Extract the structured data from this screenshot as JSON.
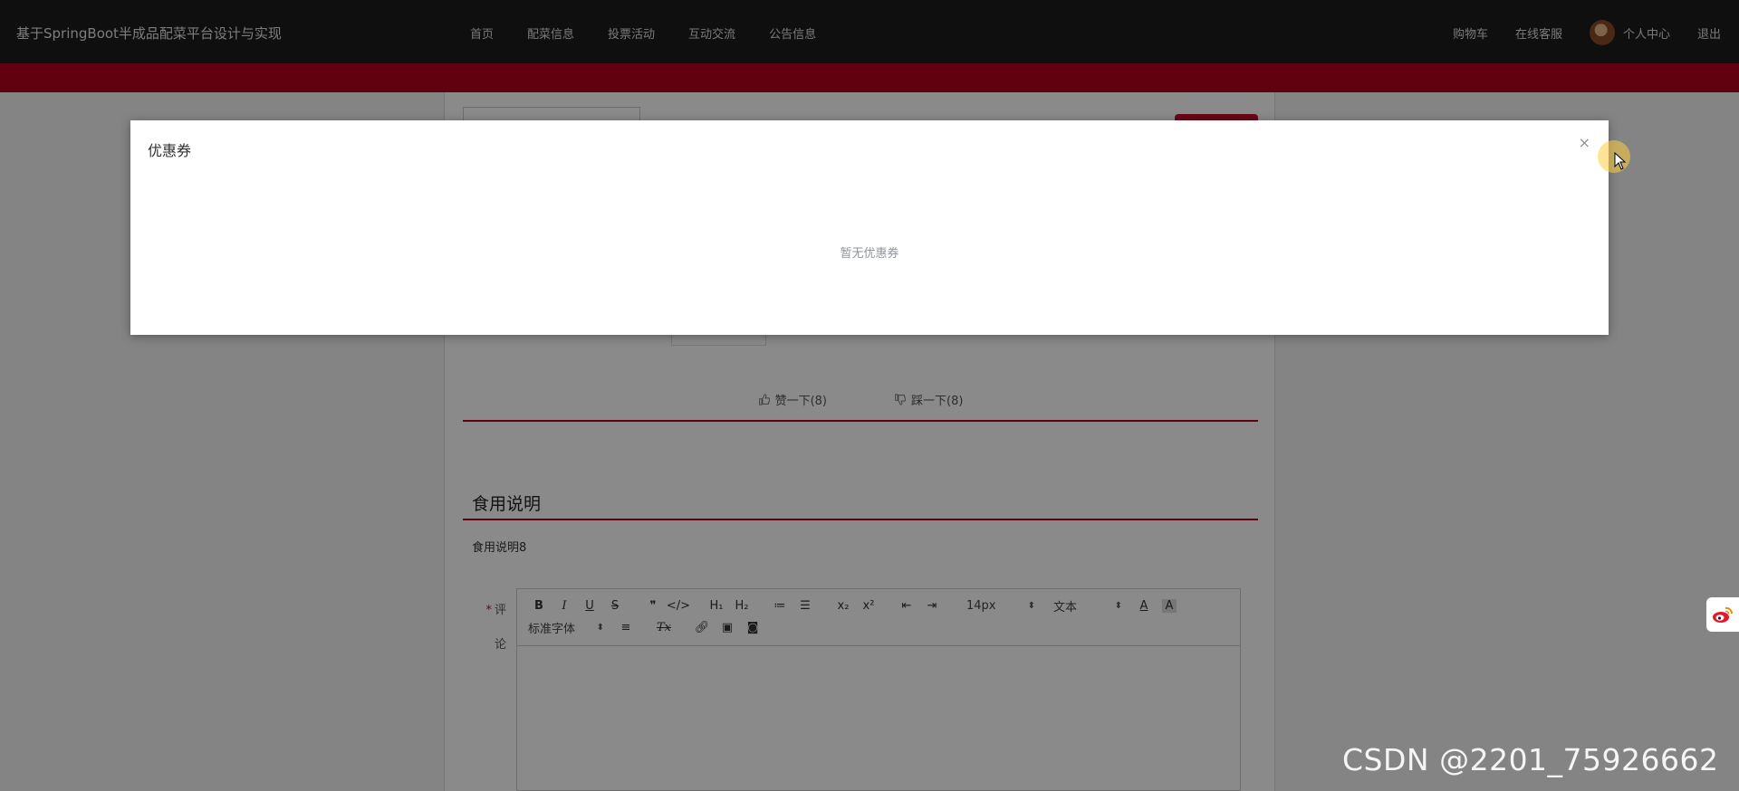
{
  "header": {
    "site_title": "基于SpringBoot半成品配菜平台设计与实现",
    "nav": [
      "首页",
      "配菜信息",
      "投票活动",
      "互动交流",
      "公告信息"
    ],
    "cart": "购物车",
    "service": "在线客服",
    "profile": "个人中心",
    "logout": "退出"
  },
  "vote": {
    "up_label": "赞一下(8)",
    "down_label": "踩一下(8)"
  },
  "usage": {
    "title": "食用说明",
    "body": "食用说明8"
  },
  "comment": {
    "label_line1": "评",
    "label_line2": "论",
    "toolbar": {
      "row1": [
        "B",
        "I",
        "U",
        "S",
        "❞",
        "</>",
        "H₁",
        "H₂",
        "≔",
        "☰",
        "x₂",
        "x²",
        "⇤",
        "⇥"
      ],
      "size_value": "14px",
      "header_value": "文本",
      "color_icon": "A",
      "bg_icon": "A",
      "font_value": "标准字体",
      "clean_icon": "Tx"
    }
  },
  "modal": {
    "title": "优惠券",
    "empty_text": "暂无优惠券",
    "close_glyph": "×"
  },
  "watermark": "CSDN @2201_75926662"
}
